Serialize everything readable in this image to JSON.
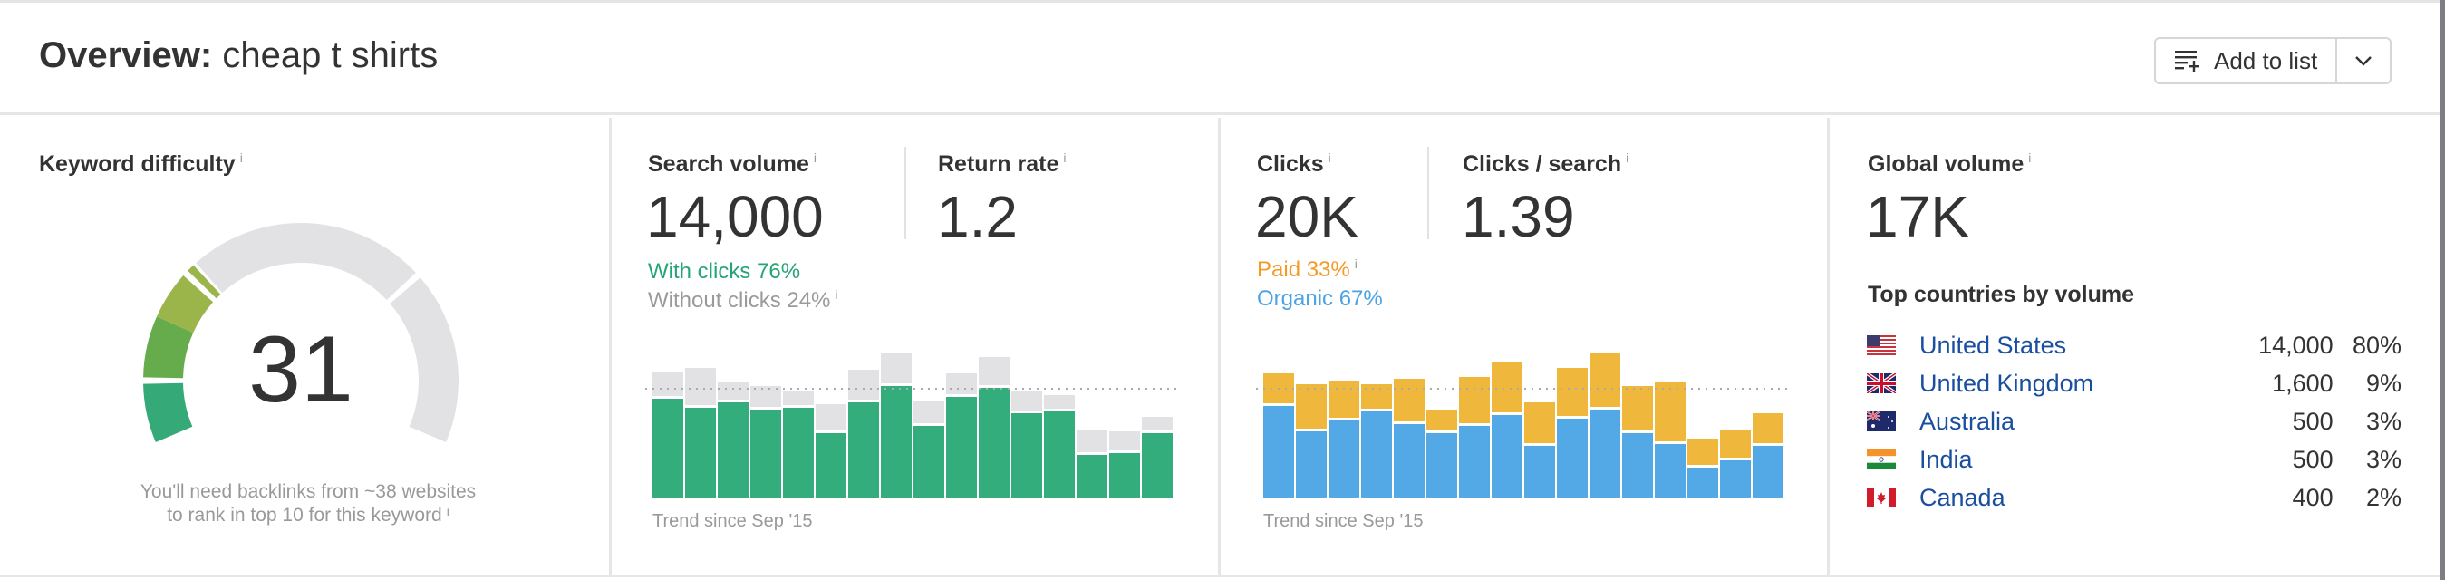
{
  "header": {
    "title_bold": "Overview:",
    "title_keyword": "cheap t shirts",
    "add_to_list_label": "Add to list",
    "add_to_list_icon": "playlist-add-icon",
    "dropdown_icon": "chevron-down-icon"
  },
  "keyword_difficulty": {
    "label": "Keyword difficulty",
    "info": "i",
    "score": "31",
    "score_value": 31,
    "scale_max": 100,
    "caption_line1": "You'll need backlinks from ~38 websites",
    "caption_line2": "to rank in top 10 for this keyword",
    "colors": {
      "low": "#35a978",
      "mid": "#67ac4c",
      "high": "#9bb54a",
      "empty": "#e2e2e4"
    }
  },
  "search_volume": {
    "label": "Search volume",
    "info": "i",
    "value": "14,000",
    "return_rate_label": "Return rate",
    "return_rate_value": "1.2",
    "with_clicks": "With clicks 76%",
    "without_clicks": "Without clicks 24%",
    "trend_label": "Trend since Sep '15",
    "colors": {
      "with_clicks": "#34ad7d",
      "without_clicks": "#e2e2e4",
      "with_clicks_text": "#25a575",
      "without_clicks_text": "#9a9a9a"
    }
  },
  "clicks": {
    "label": "Clicks",
    "info": "i",
    "value": "20K",
    "per_search_label": "Clicks / search",
    "per_search_value": "1.39",
    "paid": "Paid 33%",
    "organic": "Organic 67%",
    "trend_label": "Trend since Sep '15",
    "colors": {
      "paid": "#efb73c",
      "organic": "#52a9e6",
      "paid_text": "#f39b27",
      "organic_text": "#4aa3e4"
    }
  },
  "global_volume": {
    "label": "Global volume",
    "info": "i",
    "value": "17K",
    "top_countries_label": "Top countries by volume",
    "countries": [
      {
        "name": "United States",
        "flag": "us-flag-icon",
        "volume": "14,000",
        "share": "80%"
      },
      {
        "name": "United Kingdom",
        "flag": "uk-flag-icon",
        "volume": "1,600",
        "share": "9%"
      },
      {
        "name": "Australia",
        "flag": "au-flag-icon",
        "volume": "500",
        "share": "3%"
      },
      {
        "name": "India",
        "flag": "in-flag-icon",
        "volume": "500",
        "share": "3%"
      },
      {
        "name": "Canada",
        "flag": "ca-flag-icon",
        "volume": "400",
        "share": "2%"
      }
    ]
  },
  "chart_data": [
    {
      "type": "bar",
      "title": "Search volume trend",
      "subtitle": "Trend since Sep '15",
      "stacked": true,
      "average_line": 121,
      "ylim": [
        0,
        160
      ],
      "series": [
        {
          "name": "With clicks",
          "color": "#34ad7d",
          "values": [
            110,
            100,
            106,
            98,
            100,
            72,
            106,
            124,
            80,
            112,
            122,
            94,
            96,
            48,
            50,
            72
          ]
        },
        {
          "name": "Without clicks",
          "color": "#e2e2e4",
          "values": [
            30,
            44,
            22,
            26,
            18,
            32,
            36,
            36,
            28,
            26,
            34,
            24,
            18,
            28,
            24,
            18
          ]
        }
      ]
    },
    {
      "type": "bar",
      "title": "Clicks trend",
      "subtitle": "Trend since Sep '15",
      "stacked": true,
      "average_line": 121,
      "ylim": [
        0,
        160
      ],
      "series": [
        {
          "name": "Organic",
          "color": "#52a9e6",
          "values": [
            102,
            74,
            86,
            96,
            82,
            72,
            80,
            92,
            58,
            88,
            98,
            72,
            60,
            34,
            42,
            58
          ]
        },
        {
          "name": "Paid",
          "color": "#efb73c",
          "values": [
            36,
            52,
            44,
            30,
            50,
            26,
            54,
            58,
            48,
            56,
            62,
            52,
            68,
            32,
            34,
            36
          ]
        }
      ]
    }
  ]
}
